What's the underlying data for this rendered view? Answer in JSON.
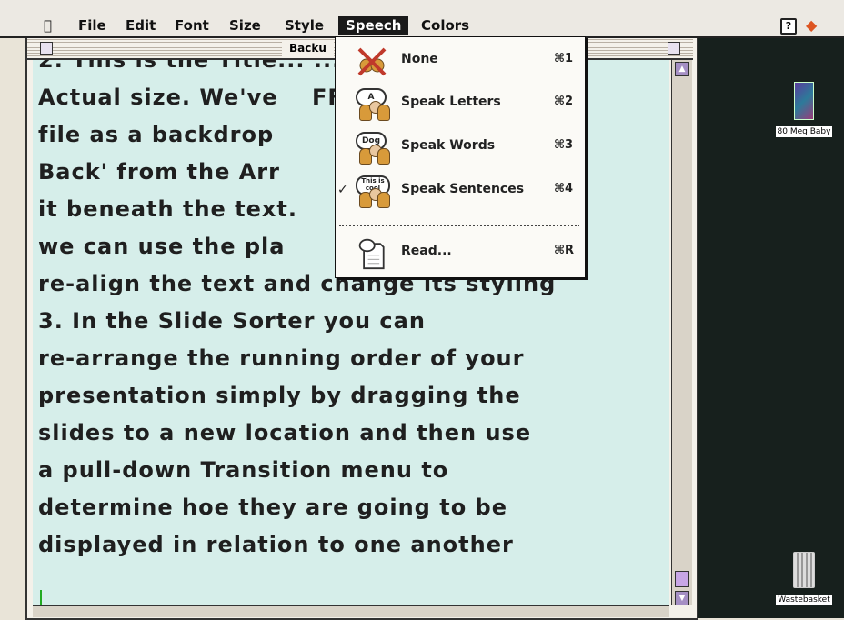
{
  "menubar": {
    "apple": "",
    "items": [
      "File",
      "Edit",
      "Font",
      "Size",
      "Style",
      "Speech",
      "Colors"
    ],
    "help": "?",
    "app_glyph": "◆"
  },
  "window": {
    "title": "Backu",
    "text": "2. This is the Title... ...\nActual size. We've    FF\nfile as a backdrop         To\nBack' from the Arr          ace\nit beneath the text.        n\nwe can use the pla\nre-align the text and change its styling\n3. In the Slide Sorter you can\nre-arrange the running order of your\npresentation simply by dragging the\nslides to a new location and then use\na pull-down Transition menu to\ndetermine hoe they are going to be\ndisplayed in relation to one another"
  },
  "speech_menu": {
    "items": [
      {
        "label": "None",
        "shortcut": "⌘1",
        "icon": "none-crossed-icon",
        "checked": false
      },
      {
        "label": "Speak Letters",
        "shortcut": "⌘2",
        "icon": "speak-letters-icon",
        "bubble": "A",
        "checked": false
      },
      {
        "label": "Speak Words",
        "shortcut": "⌘3",
        "icon": "speak-words-icon",
        "bubble": "Dog",
        "checked": false
      },
      {
        "label": "Speak Sentences",
        "shortcut": "⌘4",
        "icon": "speak-sentences-icon",
        "bubble": "This is cool",
        "checked": true
      }
    ],
    "read": {
      "label": "Read...",
      "shortcut": "⌘R",
      "icon": "read-document-icon"
    },
    "check_mark": "✓"
  },
  "desktop": {
    "disk_label": "80 Meg Baby",
    "trash_label": "Wastebasket"
  }
}
